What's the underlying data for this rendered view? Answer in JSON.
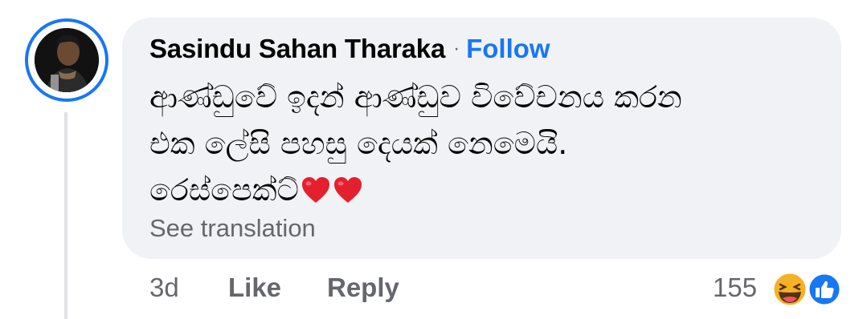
{
  "comment": {
    "author": "Sasindu Sahan Tharaka",
    "separator": "·",
    "follow_label": "Follow",
    "lines": [
      "ආණ්ඩුවේ ඉදන් ආණ්ඩුව විවේචනය කරන",
      "එක ලේසි පහසු දෙයක් නෙමෙයි.",
      "රෙස්පෙක්ට්"
    ],
    "line3_emoji": [
      "red-heart",
      "red-heart"
    ],
    "see_translation_label": "See translation"
  },
  "footer": {
    "time": "3d",
    "like_label": "Like",
    "reply_label": "Reply",
    "reaction_count": "155",
    "reaction_icons": [
      "haha-emoji",
      "like-emoji"
    ]
  },
  "colors": {
    "accent": "#1877f2",
    "bubble_bg": "#f0f2f5",
    "secondary_text": "#65676b",
    "primary_text": "#050505"
  }
}
